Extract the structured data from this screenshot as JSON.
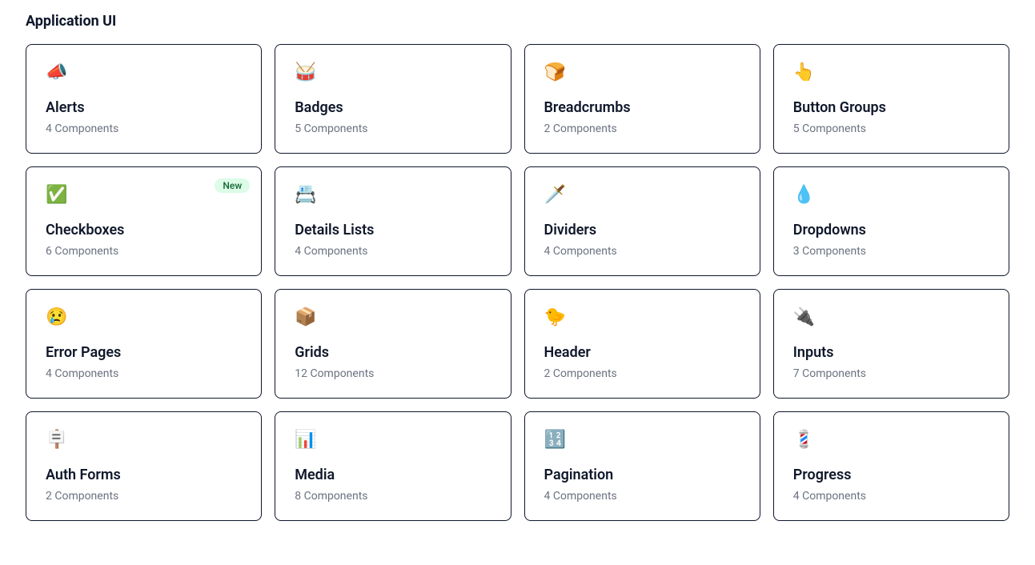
{
  "title": "Application UI",
  "badge_new": "New",
  "cards": [
    {
      "icon": "📣",
      "iconName": "megaphone-icon",
      "title": "Alerts",
      "subtitle": "4 Components",
      "badge": null
    },
    {
      "icon": "🥁",
      "iconName": "drum-icon",
      "title": "Badges",
      "subtitle": "5 Components",
      "badge": null
    },
    {
      "icon": "🍞",
      "iconName": "bread-icon",
      "title": "Breadcrumbs",
      "subtitle": "2 Components",
      "badge": null
    },
    {
      "icon": "👆",
      "iconName": "pointing-up-icon",
      "title": "Button Groups",
      "subtitle": "5 Components",
      "badge": null
    },
    {
      "icon": "✅",
      "iconName": "check-icon",
      "title": "Checkboxes",
      "subtitle": "6 Components",
      "badge": "New"
    },
    {
      "icon": "📇",
      "iconName": "card-index-icon",
      "title": "Details Lists",
      "subtitle": "4 Components",
      "badge": null
    },
    {
      "icon": "🗡️",
      "iconName": "dagger-icon",
      "title": "Dividers",
      "subtitle": "4 Components",
      "badge": null
    },
    {
      "icon": "💧",
      "iconName": "droplet-icon",
      "title": "Dropdowns",
      "subtitle": "3 Components",
      "badge": null
    },
    {
      "icon": "😢",
      "iconName": "crying-face-icon",
      "title": "Error Pages",
      "subtitle": "4 Components",
      "badge": null
    },
    {
      "icon": "📦",
      "iconName": "package-icon",
      "title": "Grids",
      "subtitle": "12 Components",
      "badge": null
    },
    {
      "icon": "🐤",
      "iconName": "baby-chick-icon",
      "title": "Header",
      "subtitle": "2 Components",
      "badge": null
    },
    {
      "icon": "🔌",
      "iconName": "electric-plug-icon",
      "title": "Inputs",
      "subtitle": "7 Components",
      "badge": null
    },
    {
      "icon": "🪧",
      "iconName": "placard-icon",
      "title": "Auth Forms",
      "subtitle": "2 Components",
      "badge": null
    },
    {
      "icon": "📊",
      "iconName": "bar-chart-icon",
      "title": "Media",
      "subtitle": "8 Components",
      "badge": null
    },
    {
      "icon": "🔢",
      "iconName": "input-numbers-icon",
      "title": "Pagination",
      "subtitle": "4 Components",
      "badge": null
    },
    {
      "icon": "💈",
      "iconName": "barber-pole-icon",
      "title": "Progress",
      "subtitle": "4 Components",
      "badge": null
    }
  ]
}
